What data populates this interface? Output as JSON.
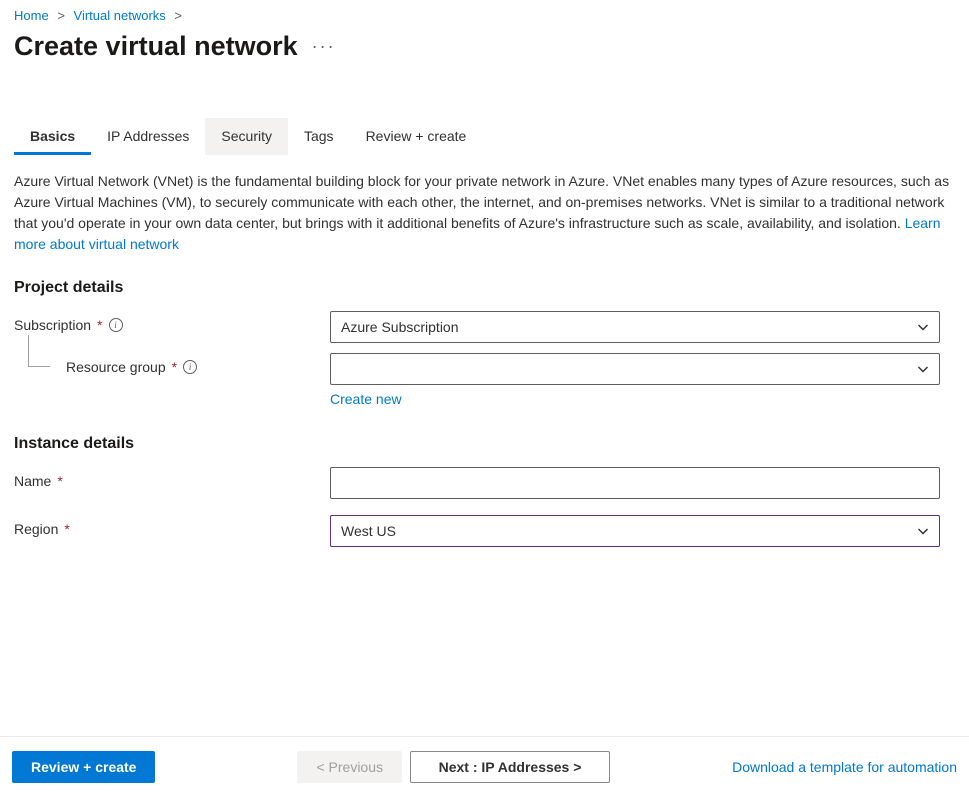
{
  "breadcrumb": {
    "items": [
      "Home",
      "Virtual networks"
    ]
  },
  "page_title": "Create virtual network",
  "tabs": {
    "items": [
      {
        "label": "Basics",
        "active": true
      },
      {
        "label": "IP Addresses",
        "active": false
      },
      {
        "label": "Security",
        "active": false,
        "highlight": true
      },
      {
        "label": "Tags",
        "active": false
      },
      {
        "label": "Review + create",
        "active": false
      }
    ]
  },
  "description": {
    "text": "Azure Virtual Network (VNet) is the fundamental building block for your private network in Azure. VNet enables many types of Azure resources, such as Azure Virtual Machines (VM), to securely communicate with each other, the internet, and on-premises networks. VNet is similar to a traditional network that you'd operate in your own data center, but brings with it additional benefits of Azure's infrastructure such as scale, availability, and isolation.  ",
    "link_text": "Learn more about virtual network"
  },
  "sections": {
    "project": {
      "title": "Project details",
      "subscription": {
        "label": "Subscription",
        "value": "Azure Subscription"
      },
      "resource_group": {
        "label": "Resource group",
        "value": "",
        "create_new": "Create new"
      }
    },
    "instance": {
      "title": "Instance details",
      "name": {
        "label": "Name",
        "value": ""
      },
      "region": {
        "label": "Region",
        "value": "West US"
      }
    }
  },
  "footer": {
    "review_create": "Review + create",
    "previous": "< Previous",
    "next": "Next : IP Addresses >",
    "download": "Download a template for automation"
  }
}
